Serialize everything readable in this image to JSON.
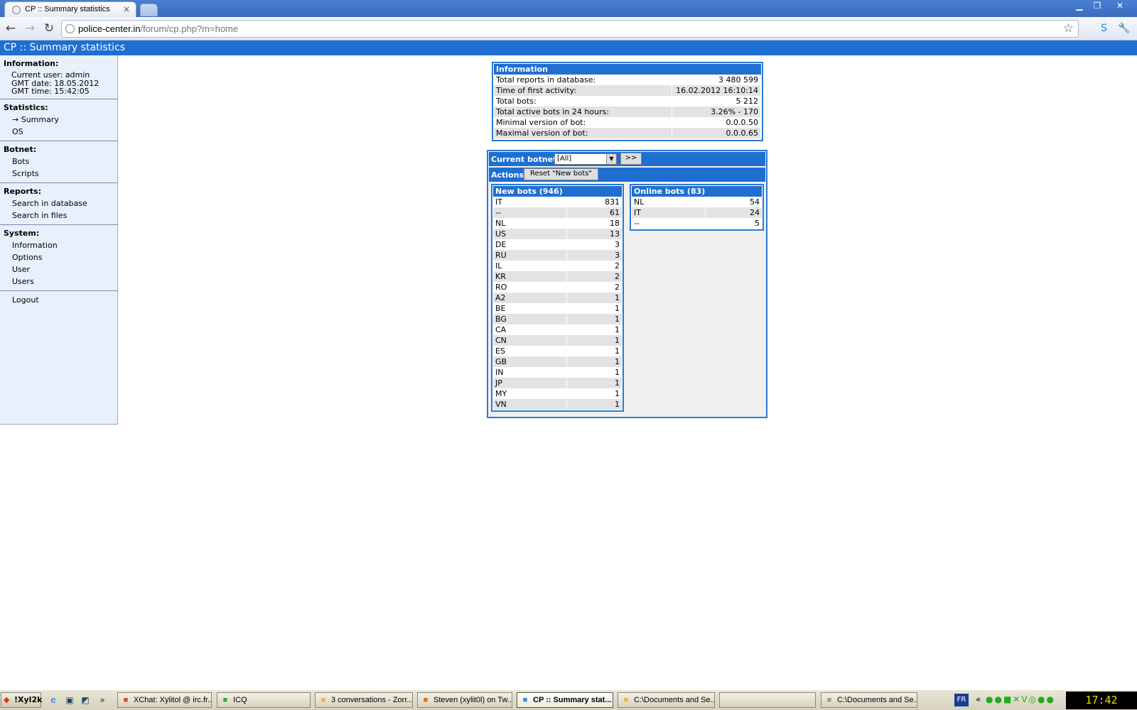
{
  "browser": {
    "tab_title": "CP :: Summary statistics",
    "tab_close": "×",
    "url_host": "police-center.in",
    "url_path": "/forum/cp.php?m=home",
    "window_controls": [
      "minimize-icon",
      "restore-icon",
      "close-icon"
    ]
  },
  "header": {
    "title": "CP :: Summary statistics"
  },
  "sidebar": {
    "information": {
      "heading": "Information:",
      "current_user": "Current user: admin",
      "gmt_date": "GMT date: 18.05.2012",
      "gmt_time": "GMT time: 15:42:05"
    },
    "statistics": {
      "heading": "Statistics:",
      "items": [
        "→ Summary",
        "OS"
      ]
    },
    "botnet": {
      "heading": "Botnet:",
      "items": [
        "Bots",
        "Scripts"
      ]
    },
    "reports": {
      "heading": "Reports:",
      "items": [
        "Search in database",
        "Search in files"
      ]
    },
    "system": {
      "heading": "System:",
      "items": [
        "Information",
        "Options",
        "User",
        "Users"
      ]
    },
    "logout": "Logout"
  },
  "info_table": {
    "title": "Information",
    "rows": [
      {
        "label": "Total reports in database:",
        "value": "3 480 599"
      },
      {
        "label": "Time of first activity:",
        "value": "16.02.2012 16:10:14"
      },
      {
        "label": "Total bots:",
        "value": "5 212"
      },
      {
        "label": "Total active bots in 24 hours:",
        "value": "3.26% - 170"
      },
      {
        "label": "Minimal version of bot:",
        "value": "0.0.0.50"
      },
      {
        "label": "Maximal version of bot:",
        "value": "0.0.0.65"
      }
    ]
  },
  "botnet_panel": {
    "current_botnet_label": "Current botnet:",
    "botnet_selected": "[All]",
    "go_button": ">>",
    "actions_label": "Actions:",
    "reset_button": "Reset \"New bots\""
  },
  "new_bots": {
    "title": "New bots (946)",
    "rows": [
      [
        "IT",
        "831"
      ],
      [
        "--",
        "61"
      ],
      [
        "NL",
        "18"
      ],
      [
        "US",
        "13"
      ],
      [
        "DE",
        "3"
      ],
      [
        "RU",
        "3"
      ],
      [
        "IL",
        "2"
      ],
      [
        "KR",
        "2"
      ],
      [
        "RO",
        "2"
      ],
      [
        "A2",
        "1"
      ],
      [
        "BE",
        "1"
      ],
      [
        "BG",
        "1"
      ],
      [
        "CA",
        "1"
      ],
      [
        "CN",
        "1"
      ],
      [
        "ES",
        "1"
      ],
      [
        "GB",
        "1"
      ],
      [
        "IN",
        "1"
      ],
      [
        "JP",
        "1"
      ],
      [
        "MY",
        "1"
      ],
      [
        "VN",
        "1"
      ]
    ]
  },
  "online_bots": {
    "title": "Online bots (83)",
    "rows": [
      [
        "NL",
        "54"
      ],
      [
        "IT",
        "24"
      ],
      [
        "--",
        "5"
      ]
    ]
  },
  "taskbar": {
    "start_label": "!Xyl2k",
    "tasks": [
      {
        "label": "XChat: Xylitol @ irc.fr...",
        "icon": "xchat-icon"
      },
      {
        "label": "ICQ",
        "icon": "icq-icon"
      },
      {
        "label": "3 conversations - Zorr...",
        "icon": "folder-icon"
      },
      {
        "label": "Steven (xylit0l) on Tw...",
        "icon": "firefox-icon"
      },
      {
        "label": "CP :: Summary stat...",
        "icon": "chrome-icon",
        "active": true
      },
      {
        "label": "C:\\Documents and Se...",
        "icon": "folder-icon"
      },
      {
        "label": "",
        "icon": ""
      },
      {
        "label": "C:\\Documents and Se...",
        "icon": "notepad-icon"
      }
    ],
    "language": "FR",
    "clock": "17:42"
  }
}
